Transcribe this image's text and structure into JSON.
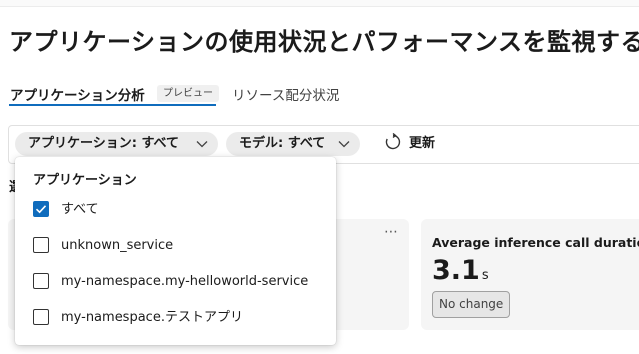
{
  "page": {
    "title": "アプリケーションの使用状況とパフォーマンスを監視する"
  },
  "tabs": {
    "active_label": "アプリケーション分析",
    "preview_badge": "プレビュー",
    "inactive_label": "リソース配分状況"
  },
  "filters": {
    "application": {
      "label": "アプリケーション: すべて",
      "icon": "chevron-down-icon"
    },
    "model": {
      "label": "モデル: すべて",
      "icon": "chevron-down-icon"
    },
    "refresh": {
      "label": "更新",
      "icon": "refresh-icon"
    }
  },
  "section": {
    "heading_visible": "選"
  },
  "dropdown": {
    "heading": "アプリケーション",
    "options": [
      {
        "label": "すべて",
        "checked": true
      },
      {
        "label": "unknown_service",
        "checked": false
      },
      {
        "label": "my-namespace.my-helloworld-service",
        "checked": false
      },
      {
        "label": "my-namespace.テストアプリ",
        "checked": false
      }
    ]
  },
  "cards": {
    "left": {
      "more": "⋯"
    },
    "right": {
      "title": "Average inference call duration",
      "value": "3.1",
      "unit": "s",
      "change": "No change"
    }
  },
  "colors": {
    "accent": "#0f6cbd",
    "pill_bg": "#ebebeb",
    "card_bg": "#f5f5f5"
  }
}
